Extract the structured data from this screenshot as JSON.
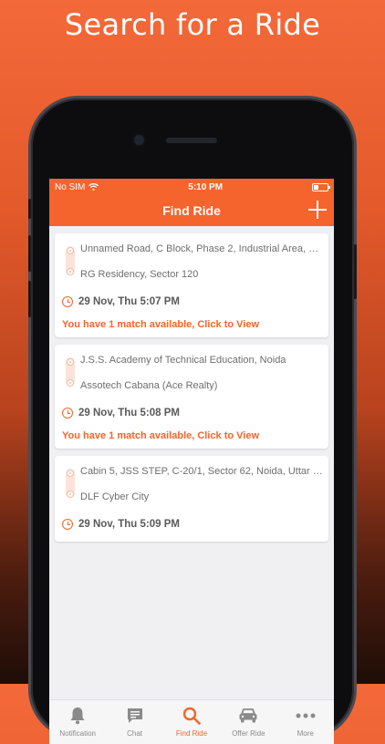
{
  "promo_title": "Search for a Ride",
  "status_bar": {
    "carrier": "No SIM",
    "time": "5:10 PM"
  },
  "nav": {
    "title": "Find Ride"
  },
  "rides": [
    {
      "from": "Unnamed Road, C Block, Phase 2, Industrial Area, S...",
      "to": "RG Residency, Sector 120",
      "time": "29 Nov, Thu 5:07 PM",
      "match": "You have 1 match available, Click to View"
    },
    {
      "from": "J.S.S. Academy of Technical Education, Noida",
      "to": "Assotech Cabana (Ace Realty)",
      "time": "29 Nov, Thu 5:08 PM",
      "match": "You have 1 match available, Click to View"
    },
    {
      "from": "Cabin 5, JSS STEP, C-20/1, Sector 62, Noida, Uttar P...",
      "to": "DLF Cyber City",
      "time": "29 Nov, Thu 5:09 PM",
      "match": ""
    }
  ],
  "tabs": [
    {
      "label": "Notification",
      "icon": "bell-icon"
    },
    {
      "label": "Chat",
      "icon": "chat-icon"
    },
    {
      "label": "Find Ride",
      "icon": "search-icon"
    },
    {
      "label": "Offer Ride",
      "icon": "car-icon"
    },
    {
      "label": "More",
      "icon": "more-icon"
    }
  ],
  "colors": {
    "accent": "#f4642c",
    "tab_inactive": "#8a8a8a"
  }
}
